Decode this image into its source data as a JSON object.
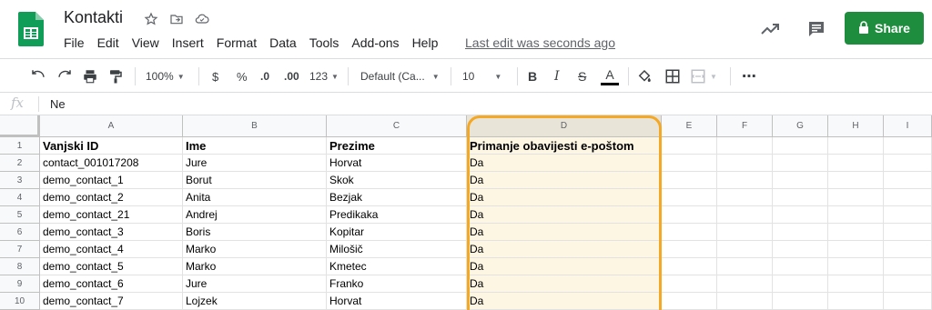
{
  "app": {
    "doc_title": "Kontakti",
    "menu": [
      "File",
      "Edit",
      "View",
      "Insert",
      "Format",
      "Data",
      "Tools",
      "Add-ons",
      "Help"
    ],
    "last_edit": "Last edit was seconds ago",
    "share_label": "Share"
  },
  "toolbar": {
    "zoom": "100%",
    "currency": "$",
    "percent": "%",
    "dec_decrease": ".0",
    "dec_increase": ".00",
    "more_formats": "123",
    "font": "Default (Ca...",
    "font_size": "10",
    "bold": "B",
    "italic": "I",
    "strike": "S",
    "text_color": "A",
    "more": "⋯"
  },
  "formula_bar": {
    "fx": "fx",
    "value": "Ne"
  },
  "columns": [
    "A",
    "B",
    "C",
    "D",
    "E",
    "F",
    "G",
    "H",
    "I"
  ],
  "rows": [
    {
      "n": "1",
      "a": "Vanjski ID",
      "b": "Ime",
      "c": "Prezime",
      "d": "Primanje obavijesti e-poštom"
    },
    {
      "n": "2",
      "a": "contact_001017208",
      "b": "Jure",
      "c": "Horvat",
      "d": "Da"
    },
    {
      "n": "3",
      "a": "demo_contact_1",
      "b": "Borut",
      "c": "Skok",
      "d": "Da"
    },
    {
      "n": "4",
      "a": "demo_contact_2",
      "b": "Anita",
      "c": "Bezjak",
      "d": "Da"
    },
    {
      "n": "5",
      "a": "demo_contact_21",
      "b": "Andrej",
      "c": "Predikaka",
      "d": "Da"
    },
    {
      "n": "6",
      "a": "demo_contact_3",
      "b": "Boris",
      "c": "Kopitar",
      "d": "Da"
    },
    {
      "n": "7",
      "a": "demo_contact_4",
      "b": "Marko",
      "c": "Milošič",
      "d": "Da"
    },
    {
      "n": "8",
      "a": "demo_contact_5",
      "b": "Marko",
      "c": "Kmetec",
      "d": "Da"
    },
    {
      "n": "9",
      "a": "demo_contact_6",
      "b": "Jure",
      "c": "Franko",
      "d": "Da"
    },
    {
      "n": "10",
      "a": "demo_contact_7",
      "b": "Lojzek",
      "c": "Horvat",
      "d": "Da"
    }
  ],
  "colors": {
    "brand_green": "#1e8e3e",
    "highlight_border": "#f4a823",
    "highlight_fill": "#fdf6e3"
  }
}
